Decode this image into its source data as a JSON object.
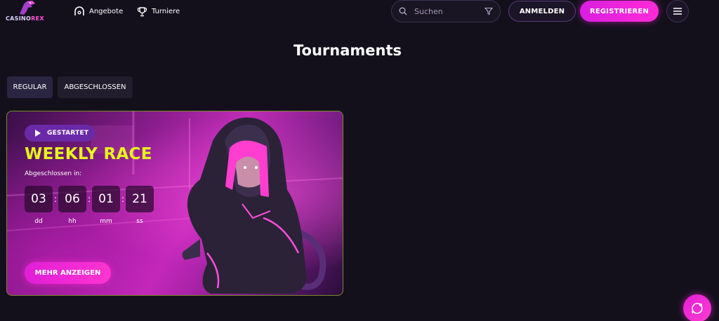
{
  "header": {
    "logo": {
      "text_main": "CASINO",
      "text_accent": "REX"
    },
    "nav": [
      {
        "label": "Angebote",
        "icon": "gift-dome-icon"
      },
      {
        "label": "Turniere",
        "icon": "trophy-icon"
      }
    ],
    "search": {
      "placeholder": "Suchen",
      "value": ""
    },
    "login_label": "ANMELDEN",
    "register_label": "REGISTRIEREN"
  },
  "page": {
    "title": "Tournaments",
    "tabs": [
      {
        "label": "REGULAR",
        "active": true
      },
      {
        "label": "ABGESCHLOSSEN",
        "active": false
      }
    ]
  },
  "tournament": {
    "status": "GESTARTET",
    "name": "WEEKLY RACE",
    "countdown_label": "Abgeschlossen in:",
    "countdown": [
      {
        "value": "03",
        "unit": "dd"
      },
      {
        "value": "06",
        "unit": "hh"
      },
      {
        "value": "01",
        "unit": "mm"
      },
      {
        "value": "21",
        "unit": "ss"
      }
    ],
    "more_label": "MEHR ANZEIGEN"
  },
  "colors": {
    "background": "#13101c",
    "accent": "#ff2bd6",
    "title_yellow": "#e6f51c",
    "badge": "#6a2aa8"
  }
}
